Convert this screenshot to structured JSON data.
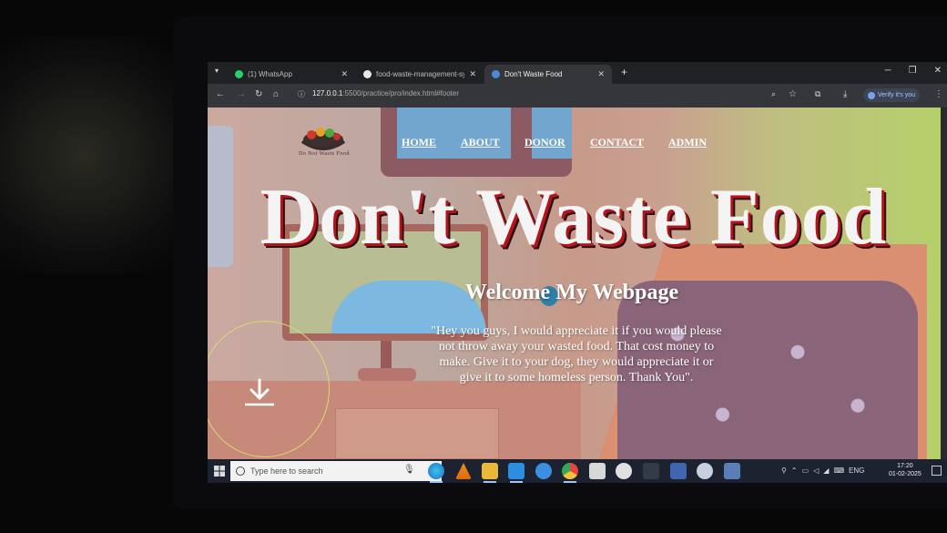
{
  "browser": {
    "tabs": [
      {
        "label": "(1) WhatsApp",
        "favicon": "whatsapp-icon",
        "active": false
      },
      {
        "label": "food-waste-management-sys",
        "favicon": "github-icon",
        "active": false
      },
      {
        "label": "Don't Waste Food",
        "favicon": "site-icon",
        "active": true
      }
    ],
    "new_tab_label": "+",
    "url_host": "127.0.0.1",
    "url_path": ":5500/practice/pro/index.html#footer",
    "profile_label": "Verify it's you"
  },
  "site": {
    "logo_text": "Do Not Waste Food",
    "nav": [
      {
        "label": "HOME"
      },
      {
        "label": "ABOUT"
      },
      {
        "label": "DONOR"
      },
      {
        "label": "CONTACT"
      },
      {
        "label": "ADMIN"
      }
    ],
    "hero_title": "Don't Waste Food",
    "welcome": "Welcome My Webpage",
    "message": "\"Hey you guys, I would appreciate it if you would please not throw away your wasted food. That cost money to make. Give it to your dog, they would appreciate it or give it to some homeless person. Thank You\".",
    "download_icon": "download-arrow-icon"
  },
  "taskbar": {
    "search_placeholder": "Type here to search",
    "language": "ENG",
    "time": "17:20",
    "date": "01-02-2025",
    "apps": [
      "edge-icon",
      "vlc-icon",
      "file-explorer-icon",
      "vscode-icon",
      "internet-explorer-icon",
      "chrome-icon",
      "store-icon",
      "github-desktop-icon",
      "app-icon",
      "app-icon",
      "app-icon",
      "app-icon"
    ]
  },
  "colors": {
    "title_shadow": "#b3141a",
    "browser_dark": "#202124",
    "toolbar": "#35363a",
    "taskbar": "#1c2230"
  }
}
